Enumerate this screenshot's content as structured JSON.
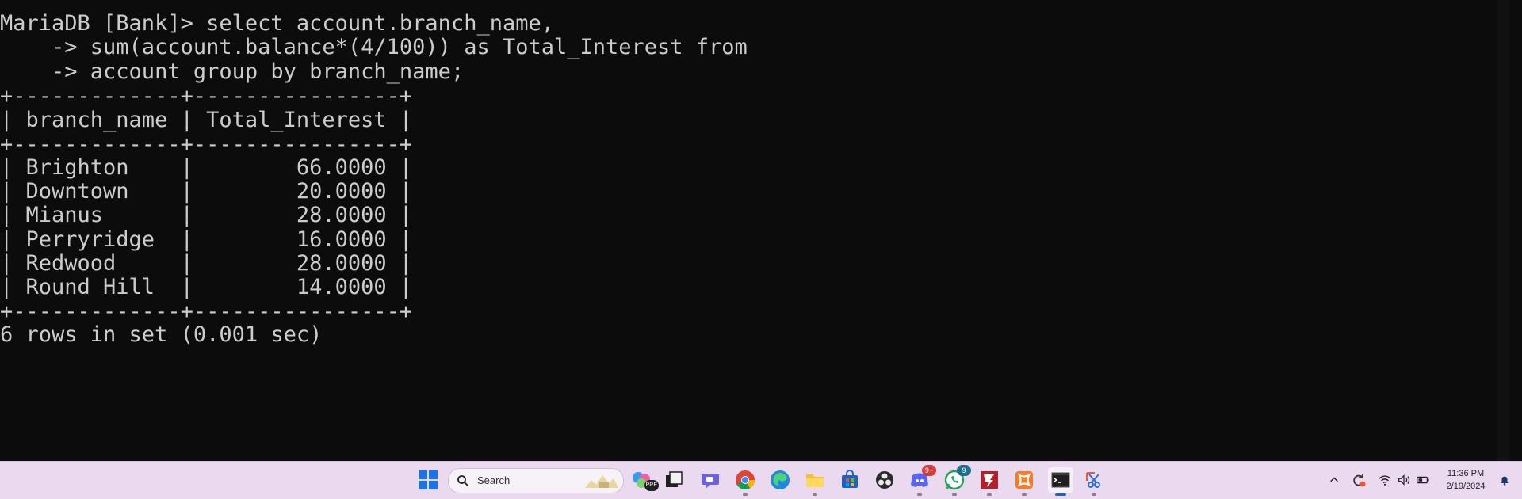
{
  "terminal": {
    "lines": [
      "MariaDB [Bank]> select account.branch_name,",
      "    -> sum(account.balance*(4/100)) as Total_Interest from",
      "    -> account group by branch_name;",
      "+-------------+----------------+",
      "| branch_name | Total_Interest |",
      "+-------------+----------------+",
      "| Brighton    |        66.0000 |",
      "| Downtown    |        20.0000 |",
      "| Mianus      |        28.0000 |",
      "| Perryridge  |        16.0000 |",
      "| Redwood     |        28.0000 |",
      "| Round Hill  |        14.0000 |",
      "+-------------+----------------+",
      "6 rows in set (0.001 sec)"
    ]
  },
  "taskbar": {
    "search_placeholder": "Search",
    "apps": [
      {
        "name": "start-button",
        "icon": "windows-logo-icon"
      },
      {
        "name": "copilot",
        "icon": "copilot-icon",
        "badge_text": "PRE"
      },
      {
        "name": "task-view",
        "icon": "task-view-icon"
      },
      {
        "name": "teams-chat",
        "icon": "chat-icon"
      },
      {
        "name": "chrome",
        "icon": "chrome-icon"
      },
      {
        "name": "edge",
        "icon": "edge-icon"
      },
      {
        "name": "file-explorer",
        "icon": "folder-icon"
      },
      {
        "name": "microsoft-store",
        "icon": "store-icon"
      },
      {
        "name": "obs",
        "icon": "obs-icon"
      },
      {
        "name": "discord",
        "icon": "discord-icon",
        "badge": "9+"
      },
      {
        "name": "whatsapp",
        "icon": "whatsapp-icon",
        "badge": "9"
      },
      {
        "name": "filezilla",
        "icon": "filezilla-icon"
      },
      {
        "name": "xampp",
        "icon": "xampp-icon"
      },
      {
        "name": "terminal",
        "icon": "terminal-icon"
      },
      {
        "name": "snipping-tool",
        "icon": "snipping-tool-icon"
      }
    ],
    "tray": {
      "clock_time": "11:36 PM",
      "clock_date": "2/19/2024"
    }
  },
  "colors": {
    "terminal_bg": "#0c0c0c",
    "terminal_fg": "#cccccc",
    "taskbar_bg": "#ebd9ef"
  }
}
